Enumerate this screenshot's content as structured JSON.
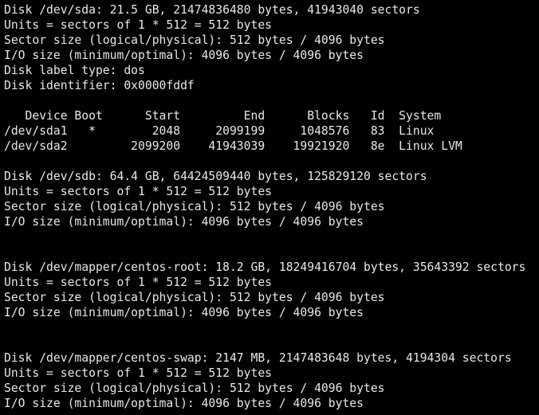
{
  "terminal": {
    "lines": [
      "Disk /dev/sda: 21.5 GB, 21474836480 bytes, 41943040 sectors",
      "Units = sectors of 1 * 512 = 512 bytes",
      "Sector size (logical/physical): 512 bytes / 4096 bytes",
      "I/O size (minimum/optimal): 4096 bytes / 4096 bytes",
      "Disk label type: dos",
      "Disk identifier: 0x0000fddf",
      "",
      "   Device Boot      Start         End      Blocks   Id  System",
      "/dev/sda1   *        2048     2099199     1048576   83  Linux",
      "/dev/sda2         2099200    41943039    19921920   8e  Linux LVM",
      "",
      "Disk /dev/sdb: 64.4 GB, 64424509440 bytes, 125829120 sectors",
      "Units = sectors of 1 * 512 = 512 bytes",
      "Sector size (logical/physical): 512 bytes / 4096 bytes",
      "I/O size (minimum/optimal): 4096 bytes / 4096 bytes",
      "",
      "",
      "Disk /dev/mapper/centos-root: 18.2 GB, 18249416704 bytes, 35643392 sectors",
      "Units = sectors of 1 * 512 = 512 bytes",
      "Sector size (logical/physical): 512 bytes / 4096 bytes",
      "I/O size (minimum/optimal): 4096 bytes / 4096 bytes",
      "",
      "",
      "Disk /dev/mapper/centos-swap: 2147 MB, 2147483648 bytes, 4194304 sectors",
      "Units = sectors of 1 * 512 = 512 bytes",
      "Sector size (logical/physical): 512 bytes / 4096 bytes",
      "I/O size (minimum/optimal): 4096 bytes / 4096 bytes"
    ]
  }
}
